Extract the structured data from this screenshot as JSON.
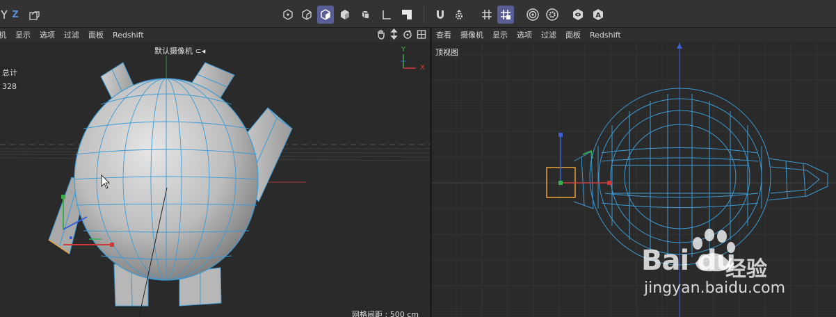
{
  "toolbar": {
    "axis_z": "Z",
    "colors": {
      "active": "#5a5e96",
      "bg": "#333333"
    },
    "icons": [
      "axis-z-icon",
      "coordinate-icon",
      "points-mode-icon",
      "edges-mode-icon",
      "polygons-mode-icon",
      "model-mode-icon",
      "texture-mode-icon",
      "object-axis-icon",
      "workplane-icon",
      "solo-icon",
      "snap-magnet-icon",
      "snap-settings-icon",
      "grid-snap-icon",
      "quantize-icon",
      "render-region-icon",
      "render-settings-icon",
      "view-icon",
      "annotate-icon"
    ]
  },
  "left_view": {
    "menu": [
      "机",
      "显示",
      "选项",
      "过滤",
      "面板",
      "Redshift"
    ],
    "camera_label": "默认摄像机",
    "stats_title": "总计",
    "stats_value": "328",
    "grid_spacing": "网格间距 : 500 cm",
    "axis_y": "Y",
    "axis_x": "X"
  },
  "right_view": {
    "menu": [
      "查看",
      "摄像机",
      "显示",
      "选项",
      "过滤",
      "面板",
      "Redshift"
    ],
    "view_label": "顶视图"
  },
  "watermark": {
    "brand": "Bai",
    "brand2": "du",
    "cn": "经验",
    "url": "jingyan.baidu.com"
  },
  "scene_colors": {
    "wire": "#3d9bd4",
    "mesh": "#b9b9b9",
    "selected": "#e8a23a",
    "axis_x": "#d23a3a",
    "axis_y": "#36b04b",
    "axis_z": "#3a62d6"
  }
}
